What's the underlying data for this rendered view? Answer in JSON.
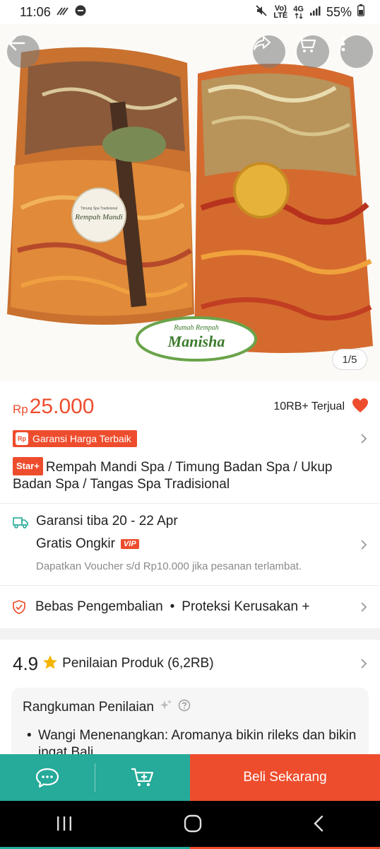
{
  "status_bar": {
    "time": "11:06",
    "network_top": "Vo)",
    "network_bottom": "LTE",
    "net_4g": "4G",
    "battery": "55%"
  },
  "hero": {
    "image_counter": "1/5",
    "label_text": "Rempah Mandi",
    "label_subtext": "Timung Spa Tradisional",
    "brand_top": "Rumah Rempah",
    "brand_name": "Manisha"
  },
  "product": {
    "currency": "Rp",
    "price": "25.000",
    "sold": "10RB+ Terjual",
    "guarantee": "Garansi Harga Terbaik",
    "guarantee_logo": "Rp",
    "star_badge": "Star+",
    "title": "Rempah Mandi Spa / Timung Badan Spa / Ukup Badan Spa / Tangas Spa Tradisional"
  },
  "shipping": {
    "arrival": "Garansi tiba 20 - 22 Apr",
    "free_shipping": "Gratis Ongkir",
    "vip": "VIP",
    "voucher_note": "Dapatkan Voucher s/d Rp10.000 jika pesanan terlambat."
  },
  "returns": {
    "return_label": "Bebas Pengembalian",
    "separator": "•",
    "protection_label": "Proteksi Kerusakan +"
  },
  "rating": {
    "score": "4.9",
    "label": "Penilaian Produk (6,2RB)"
  },
  "summary": {
    "title": "Rangkuman Penilaian",
    "bullet": "•",
    "item": "Wangi Menenangkan: Aromanya bikin rileks dan bikin ingat Bali"
  },
  "bottom_bar": {
    "buy_label": "Beli Sekarang"
  },
  "colors": {
    "primary": "#ee4d2d",
    "teal": "#26aa99"
  }
}
